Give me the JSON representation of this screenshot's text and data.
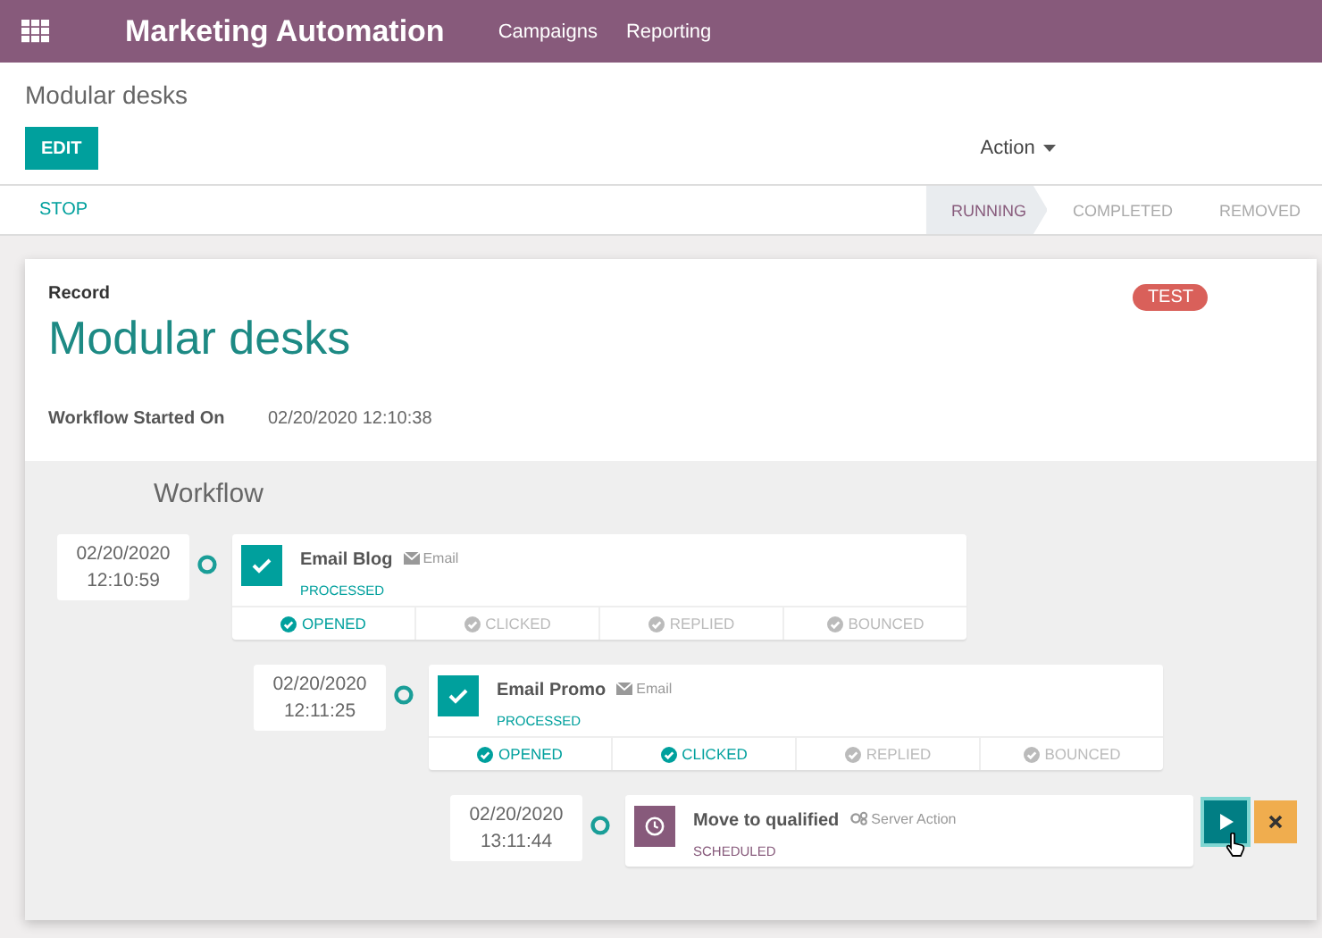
{
  "navbar": {
    "title": "Marketing Automation",
    "menu": [
      {
        "label": "Campaigns"
      },
      {
        "label": "Reporting"
      }
    ]
  },
  "breadcrumb": "Modular desks",
  "edit_button": "EDIT",
  "action_menu": "Action",
  "stop_button": "STOP",
  "stages": [
    {
      "label": "RUNNING",
      "selected": true
    },
    {
      "label": "COMPLETED",
      "selected": false
    },
    {
      "label": "REMOVED",
      "selected": false
    }
  ],
  "record": {
    "label": "Record",
    "name": "Modular desks",
    "badge": "TEST",
    "fields": [
      {
        "label": "Workflow Started On",
        "value": "02/20/2020 12:10:38"
      }
    ]
  },
  "workflow": {
    "title": "Workflow",
    "activities": [
      {
        "kind": "email",
        "date": "02/20/2020",
        "time": "12:10:59",
        "name": "Email Blog",
        "type_label": "Email",
        "status": "PROCESSED",
        "stats": [
          {
            "label": "OPENED",
            "done": true
          },
          {
            "label": "CLICKED",
            "done": false
          },
          {
            "label": "REPLIED",
            "done": false
          },
          {
            "label": "BOUNCED",
            "done": false
          }
        ],
        "children": [
          {
            "kind": "email",
            "date": "02/20/2020",
            "time": "12:11:25",
            "name": "Email Promo",
            "type_label": "Email",
            "status": "PROCESSED",
            "stats": [
              {
                "label": "OPENED",
                "done": true
              },
              {
                "label": "CLICKED",
                "done": true
              },
              {
                "label": "REPLIED",
                "done": false
              },
              {
                "label": "BOUNCED",
                "done": false
              }
            ],
            "children": [
              {
                "kind": "server_action",
                "date": "02/20/2020",
                "time": "13:11:44",
                "name": "Move to qualified",
                "type_label": "Server Action",
                "status": "SCHEDULED",
                "actions": [
                  {
                    "kind": "run"
                  },
                  {
                    "kind": "cancel"
                  }
                ]
              }
            ]
          }
        ]
      }
    ]
  }
}
